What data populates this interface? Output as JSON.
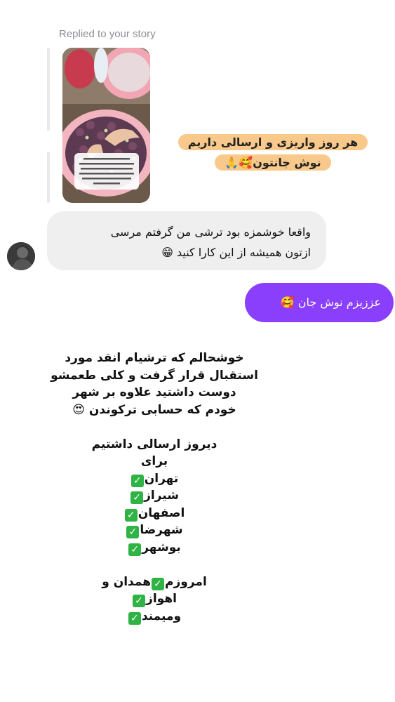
{
  "story_reply": {
    "label": "Replied to your story",
    "caption_lines": [
      "هر روز واریزی و ارسالی داریم",
      "نوش جانتون🥰🙏"
    ]
  },
  "incoming_message": {
    "lines": [
      "واقعا خوشمزه بود ترشی من گرفتم مرسی",
      "ازتون همیشه از این کارا کنید 😁"
    ]
  },
  "outgoing_message": {
    "text": "عززیزم نوش جان 🥰"
  },
  "announcement": {
    "lines": [
      {
        "text": "خوشحالم که ترشیام انقد مورد",
        "check": false
      },
      {
        "text": "استقبال قرار گرفت و کلی طعمشو",
        "check": false
      },
      {
        "text": "دوست داشتید علاوه بر شهر",
        "check": false
      },
      {
        "text": "خودم که حسابی ترکوندن 😍",
        "check": false
      },
      {
        "text": "",
        "check": false
      },
      {
        "text": "دیروز ارسالی داشتیم",
        "check": false
      },
      {
        "text": "برای",
        "check": false
      },
      {
        "text": "تهران",
        "check": true
      },
      {
        "text": "شیراز",
        "check": true
      },
      {
        "text": "اصفهان",
        "check": true
      },
      {
        "text": "شهرضا",
        "check": true
      },
      {
        "text": "بوشهر",
        "check": true
      },
      {
        "text": "",
        "check": false
      },
      {
        "text": "امروزم",
        "check": true,
        "suffix": "همدان و"
      },
      {
        "text": "اهواز",
        "check": true
      },
      {
        "text": "ومیمند",
        "check": true
      }
    ]
  },
  "colors": {
    "outgoing_bubble": "#8a3ffc",
    "incoming_bubble": "#efeff0",
    "caption_highlight": "#f8c98b",
    "check": "#2fb344"
  }
}
